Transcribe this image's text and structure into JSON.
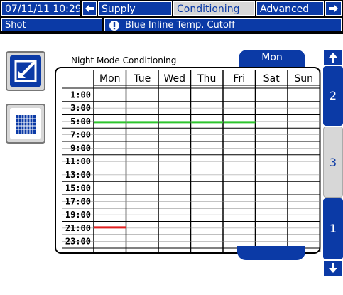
{
  "topbar": {
    "datetime": "07/11/11 10:29",
    "tabs": [
      {
        "label": "Supply"
      },
      {
        "label": "Conditioning"
      },
      {
        "label": "Advanced"
      }
    ]
  },
  "statusbar": {
    "mode": "Shot",
    "alert_text": "Blue Inline Temp. Cutoff"
  },
  "schedule": {
    "title": "Night Mode Conditioning",
    "selected_day": "Mon",
    "days": [
      "Mon",
      "Tue",
      "Wed",
      "Thu",
      "Fri",
      "Sat",
      "Sun"
    ],
    "hours": [
      "1:00",
      "3:00",
      "5:00",
      "7:00",
      "9:00",
      "11:00",
      "13:00",
      "15:00",
      "17:00",
      "19:00",
      "21:00",
      "23:00"
    ],
    "green_line": {
      "label": "on",
      "color": "#2ec52e",
      "days": [
        "Mon",
        "Tue",
        "Wed",
        "Thu",
        "Fri"
      ],
      "hour": 5
    },
    "red_line": {
      "label": "off",
      "color": "#e02020",
      "days": [
        "Mon"
      ],
      "hour": 21
    }
  },
  "scrollbar": {
    "pages": [
      "2",
      "3",
      "1"
    ],
    "active_page": "3"
  },
  "colors": {
    "accent": "#0b3aa6",
    "panel": "#d7d7d7"
  }
}
